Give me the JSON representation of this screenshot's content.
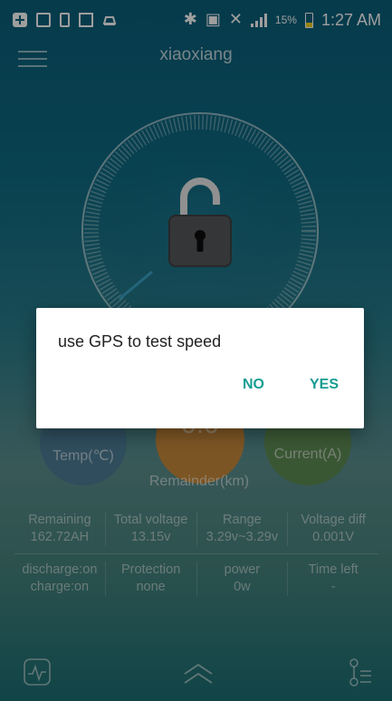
{
  "status_bar": {
    "battery_percent": "15%",
    "time": "1:27 AM",
    "icons": [
      "plus-box-icon",
      "image-icon",
      "device-icon",
      "expand-icon",
      "car-alert-icon",
      "bluetooth-icon",
      "nfc-icon",
      "mute-icon",
      "signal-icon",
      "battery-icon"
    ]
  },
  "header": {
    "title": "xiaoxiang"
  },
  "dialog": {
    "message": "use GPS to test speed",
    "no_label": "NO",
    "yes_label": "YES"
  },
  "gauges": {
    "temp_label": "Temp(℃)",
    "remainder_value": "0.0",
    "remainder_label": "Remainder(km)",
    "current_label": "Current(A)"
  },
  "stats": {
    "row1": [
      {
        "label": "Remaining",
        "value": "162.72AH"
      },
      {
        "label": "Total voltage",
        "value": "13.15v"
      },
      {
        "label": "Range",
        "value": "3.29v~3.29v"
      },
      {
        "label": "Voltage diff",
        "value": "0.001V"
      }
    ],
    "row2": [
      {
        "label": "discharge:on",
        "value": "charge:on"
      },
      {
        "label": "Protection",
        "value": "none"
      },
      {
        "label": "power",
        "value": "0w"
      },
      {
        "label": "Time left",
        "value": "-"
      }
    ]
  },
  "colors": {
    "accent": "#169d92",
    "dialog_bg": "#ffffff"
  }
}
